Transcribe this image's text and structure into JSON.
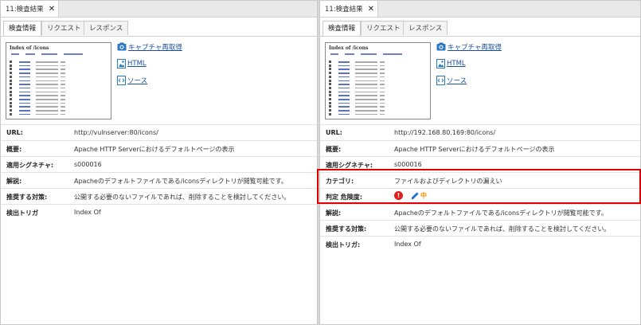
{
  "left": {
    "tab_title": "11:検査結果",
    "subtabs": [
      "検査情報",
      "リクエスト",
      "レスポンス"
    ],
    "links": {
      "recapture": "キャプチャ再取得",
      "html": "HTML",
      "source": "ソース"
    },
    "rows": [
      {
        "label": "URL:",
        "value": "http://vulnserver:80/icons/"
      },
      {
        "label": "概要:",
        "value": "Apache HTTP Serverにおけるデフォルトページの表示"
      },
      {
        "label": "適用シグネチャ:",
        "value": "s000016"
      },
      {
        "label": "解説:",
        "value": "Apacheのデフォルトファイルである/iconsディレクトリが閲覧可能です。"
      },
      {
        "label": "推奨する対策:",
        "value": "公開する必要のないファイルであれば、削除することを検討してください。"
      },
      {
        "label": "検出トリガ",
        "value": "Index Of"
      }
    ]
  },
  "right": {
    "tab_title": "11:検査結果",
    "subtabs": [
      "検査情報",
      "リクエスト",
      "レスポンス"
    ],
    "links": {
      "recapture": "キャプチャ再取得",
      "html": "HTML",
      "source": "ソース"
    },
    "rows": [
      {
        "label": "URL:",
        "value": "http://192.168.80.169:80/icons/"
      },
      {
        "label": "概要:",
        "value": "Apache HTTP Serverにおけるデフォルトページの表示"
      },
      {
        "label": "適用シグネチャ:",
        "value": "s000016"
      },
      {
        "label": "カテゴリ:",
        "value": "ファイルおよびディレクトリの漏えい"
      },
      {
        "label": "判定 危険度:",
        "value": ""
      },
      {
        "label": "解説:",
        "value": "Apacheのデフォルトファイルである/iconsディレクトリが閲覧可能です。"
      },
      {
        "label": "推奨する対策:",
        "value": "公開する必要のないファイルであれば、削除することを検討してください。"
      },
      {
        "label": "検出トリガ:",
        "value": "Index Of"
      }
    ],
    "risk": {
      "judgement_icon": "exclamation-icon",
      "edit_icon": "pencil-icon",
      "severity": "中"
    }
  },
  "thumbnail": {
    "title": "Index of /icons"
  },
  "colors": {
    "highlight_border": "#e00000",
    "link": "#1a4f9c",
    "judgement_red": "#e21d1d",
    "severity_orange": "#ef8a00",
    "edit_blue": "#1e6fd0"
  }
}
